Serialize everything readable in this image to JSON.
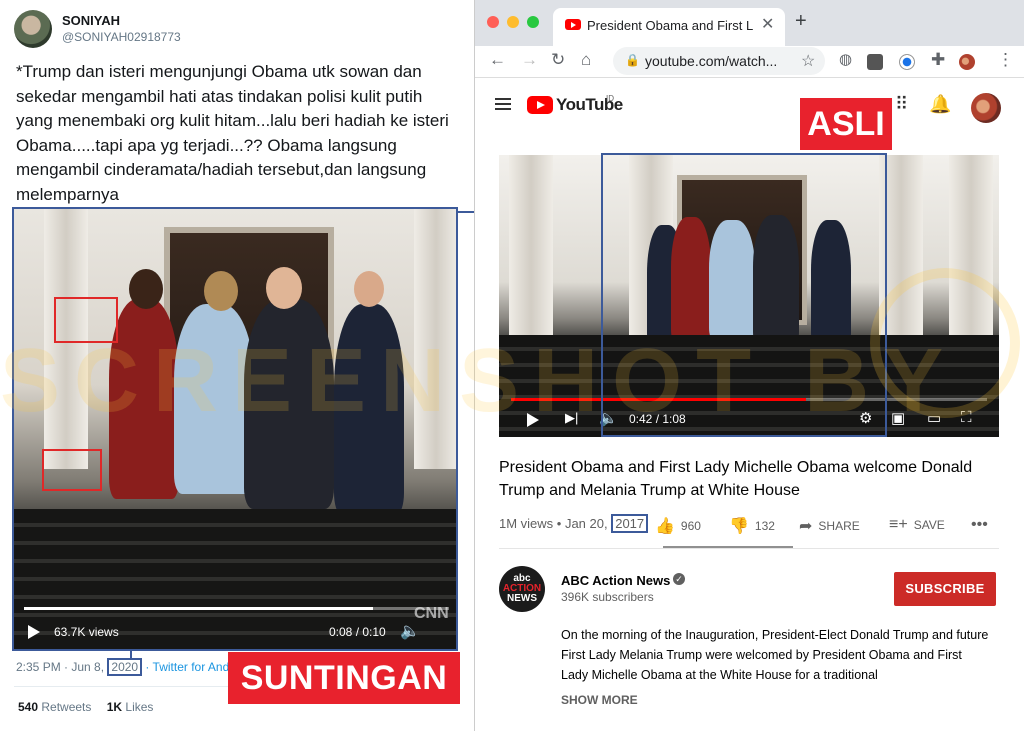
{
  "tweet": {
    "display_name": "SONIYAH",
    "handle": "@SONIYAH02918773",
    "text": "*Trump dan isteri mengunjungi Obama utk sowan dan sekedar mengambil hati atas tindakan polisi  kulit putih yang menembaki org kulit hitam...lalu beri hadiah ke isteri Obama.....tapi apa yg terjadi...?? Obama langsung mengambil cinderamata/hadiah tersebut,dan langsung melemparnya",
    "video": {
      "views": "63.7K views",
      "time": "0:08 / 0:10",
      "progress": 0.82
    },
    "meta_prefix": "2:35 PM · Jun 8, ",
    "meta_year": "2020",
    "meta_source": " · Twitter for Android",
    "retweets_count": "540",
    "retweets_label": " Retweets",
    "likes_count": "1K",
    "likes_label": " Likes"
  },
  "labels": {
    "edited": "SUNTINGAN",
    "original": "ASLI"
  },
  "browser": {
    "tab_title": "President Obama and First Lady Michelle Obama welcome",
    "url": "youtube.com/watch..."
  },
  "youtube": {
    "logo_text": "YouTube",
    "logo_region": "ID",
    "video": {
      "time": "0:42 / 1:08",
      "progress": 0.62
    },
    "title": "President Obama and First Lady Michelle Obama welcome Donald Trump and Melania Trump at White House",
    "views_date_prefix": "1M views • Jan 20, ",
    "views_date_year": "2017",
    "likes": "960",
    "dislikes": "132",
    "share_label": "SHARE",
    "save_label": "SAVE",
    "channel_name": "ABC Action News",
    "channel_subs": "396K subscribers",
    "subscribe_label": "SUBSCRIBE",
    "description": "On the morning of the Inauguration, President-Elect Donald Trump and future First Lady Melania Trump were welcomed by President Obama and First Lady Michelle Obama at the White House for a traditional",
    "show_more": "SHOW MORE"
  },
  "colors": {
    "highlight_box": "#3c5a9a",
    "label_red": "#e8222d",
    "youtube_red": "#ff0000"
  }
}
